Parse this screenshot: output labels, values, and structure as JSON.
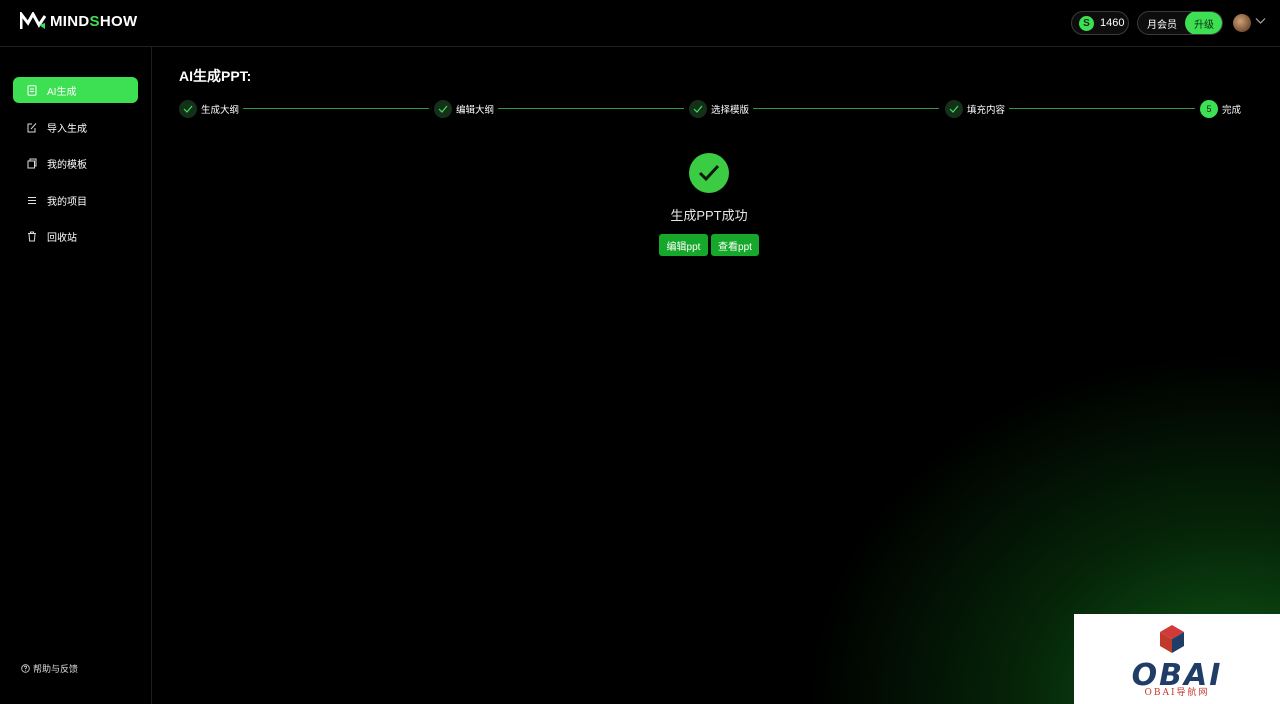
{
  "brand": {
    "logo_prefix": "MIND",
    "logo_s": "S",
    "logo_suffix": "HOW"
  },
  "header": {
    "coin_symbol": "S",
    "coin_count": "1460",
    "member_label": "月会员",
    "upgrade_label": "升级"
  },
  "sidebar": {
    "items": [
      {
        "label": "AI生成",
        "icon": "document-icon",
        "active": true
      },
      {
        "label": "导入生成",
        "icon": "edit-icon",
        "active": false
      },
      {
        "label": "我的模板",
        "icon": "template-icon",
        "active": false
      },
      {
        "label": "我的项目",
        "icon": "list-icon",
        "active": false
      },
      {
        "label": "回收站",
        "icon": "trash-icon",
        "active": false
      }
    ],
    "help_label": "帮助与反馈"
  },
  "main": {
    "title": "AI生成PPT:",
    "steps": [
      {
        "label": "生成大纲",
        "state": "done"
      },
      {
        "label": "编辑大纲",
        "state": "done"
      },
      {
        "label": "选择模版",
        "state": "done"
      },
      {
        "label": "填充内容",
        "state": "done"
      },
      {
        "label": "完成",
        "state": "current",
        "number": "5"
      }
    ],
    "success_message": "生成PPT成功",
    "edit_button": "编辑ppt",
    "view_button": "查看ppt"
  },
  "watermark": {
    "title": "OBAI",
    "subtitle": "OBAI导航网"
  },
  "colors": {
    "accent": "#3ee053",
    "button": "#16a82a",
    "background": "#000000"
  }
}
